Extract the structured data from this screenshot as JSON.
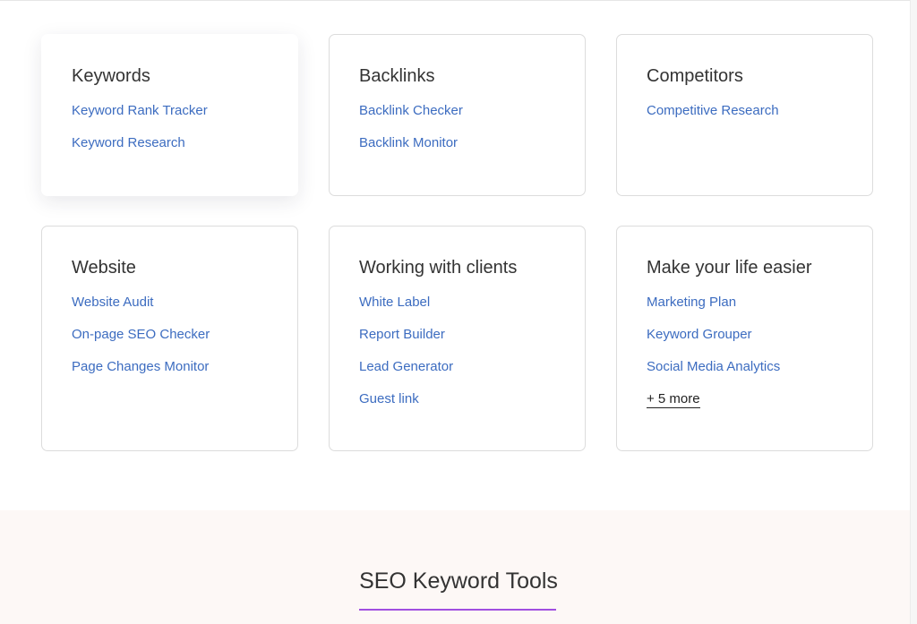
{
  "cards": [
    {
      "title": "Keywords",
      "links": [
        "Keyword Rank Tracker",
        "Keyword Research"
      ]
    },
    {
      "title": "Backlinks",
      "links": [
        "Backlink Checker",
        "Backlink Monitor"
      ]
    },
    {
      "title": "Competitors",
      "links": [
        "Competitive Research"
      ]
    },
    {
      "title": "Website",
      "links": [
        "Website Audit",
        "On-page SEO Checker",
        "Page Changes Monitor"
      ]
    },
    {
      "title": "Working with clients",
      "links": [
        "White Label",
        "Report Builder",
        "Lead Generator",
        "Guest link"
      ]
    },
    {
      "title": "Make your life easier",
      "links": [
        "Marketing Plan",
        "Keyword Grouper",
        "Social Media Analytics"
      ],
      "more": "+ 5 more"
    }
  ],
  "tools_section": {
    "title": "SEO Keyword Tools"
  },
  "colors": {
    "link": "#3c6cc0",
    "accent_underline": "#a14fe0",
    "section_bg": "#fdf8f6"
  }
}
